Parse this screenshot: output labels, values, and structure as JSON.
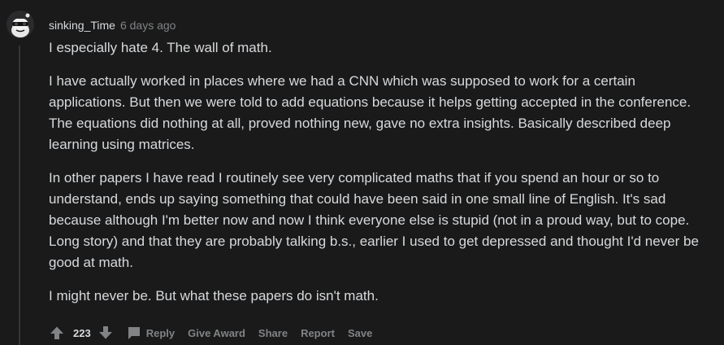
{
  "comment": {
    "username": "sinking_Time",
    "timestamp": "6 days ago",
    "paragraphs": [
      "I especially hate 4. The wall of math.",
      "I have actually worked in places where we had a CNN which was supposed to work for a certain applications. But then we were told to add equations because it helps getting accepted in the conference. The equations did nothing at all, proved nothing new, gave no extra insights. Basically described deep learning using matrices.",
      "In other papers I have read I routinely see very complicated maths that if you spend an hour or so to understand, ends up saying something that could have been said in one small line of English. It's sad because although I'm better now and now I think everyone else is stupid (not in a proud way, but to cope. Long story) and that they are probably talking b.s., earlier I used to get depressed and thought I'd never be good at math.",
      "I might never be. But what these papers do isn't math."
    ],
    "votes": "223",
    "actions": {
      "reply": "Reply",
      "give_award": "Give Award",
      "share": "Share",
      "report": "Report",
      "save": "Save"
    },
    "icons": {
      "avatar": "snoo-avatar-icon",
      "upvote": "upvote-arrow-icon",
      "downvote": "downvote-arrow-icon",
      "reply": "speech-bubble-icon"
    }
  },
  "colors": {
    "background": "#1a1a1b",
    "text": "#d7dadc",
    "muted": "#818384",
    "thread_line": "#343536"
  }
}
